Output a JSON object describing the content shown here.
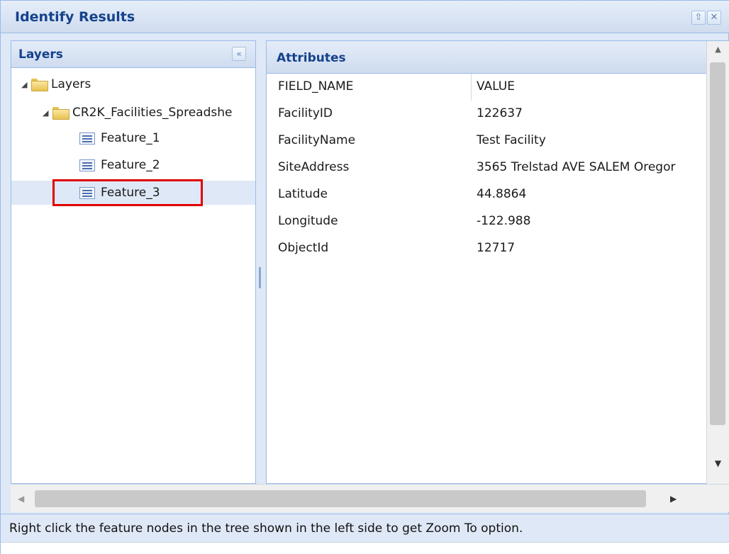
{
  "window": {
    "title": "Identify Results"
  },
  "layers_panel": {
    "title": "Layers",
    "tree": {
      "root": "Layers",
      "group": "CR2K_Facilities_Spreadshe",
      "features": [
        "Feature_1",
        "Feature_2",
        "Feature_3"
      ],
      "selected": "Feature_3"
    }
  },
  "attributes_panel": {
    "title": "Attributes",
    "columns": [
      "FIELD_NAME",
      "VALUE"
    ],
    "rows": [
      {
        "field": "FacilityID",
        "value": "122637"
      },
      {
        "field": "FacilityName",
        "value": "Test Facility"
      },
      {
        "field": "SiteAddress",
        "value": "3565 Trelstad AVE SALEM Oregor"
      },
      {
        "field": "Latitude",
        "value": "44.8864"
      },
      {
        "field": "Longitude",
        "value": "-122.988"
      },
      {
        "field": "ObjectId",
        "value": "12717"
      }
    ]
  },
  "footer": {
    "hint": "Right click the feature nodes in the tree shown in the left side to get Zoom To option."
  },
  "colors": {
    "header_text": "#15428b",
    "panel_bg": "#dfe8f6",
    "border": "#99bbe8",
    "highlight": "#e10000"
  }
}
